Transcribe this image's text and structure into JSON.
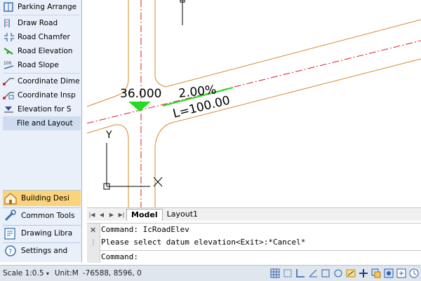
{
  "left_panel": {
    "tools": [
      {
        "label": "Parking Arrange",
        "icon": "parking-icon"
      },
      {
        "label": "Draw Road",
        "icon": "draw-road-icon"
      },
      {
        "label": "Road Chamfer",
        "icon": "road-chamfer-icon"
      },
      {
        "label": "Road Elevation",
        "icon": "road-elevation-icon"
      },
      {
        "label": "Road Slope",
        "icon": "road-slope-icon"
      },
      {
        "label": "Coordinate Dime",
        "icon": "coordinate-dim-icon"
      },
      {
        "label": "Coordinate Insp",
        "icon": "coordinate-inspect-icon"
      },
      {
        "label": "Elevation for S",
        "icon": "elevation-icon"
      },
      {
        "label": "File and Layout",
        "icon": ""
      }
    ],
    "categories": [
      {
        "label": "Building Desi",
        "icon": "building-icon",
        "active": true
      },
      {
        "label": "Common Tools",
        "icon": "tools-icon"
      },
      {
        "label": "Drawing Libra",
        "icon": "library-icon"
      },
      {
        "label": "Settings and",
        "icon": "settings-help-icon"
      }
    ]
  },
  "drawing": {
    "elevation_label": "36.000",
    "slope_label": "2.00%",
    "length_label": "L=100.00",
    "ucs_y_label": "Y",
    "colors": {
      "road_edge": "#d4892a",
      "centerline": "#d3202a",
      "marker": "#22dd22"
    }
  },
  "tabs": {
    "model": "Model",
    "layout1": "Layout1",
    "active": "Model"
  },
  "command": {
    "line1": "Command: IcRoadElev",
    "line2": "Please select datum elevation<Exit>:*Cancel*",
    "prompt": "Command:"
  },
  "statusbar": {
    "scale": "Scale 1:0.5",
    "unit": "Unit:M",
    "coords": "-76588, 8596, 0"
  }
}
